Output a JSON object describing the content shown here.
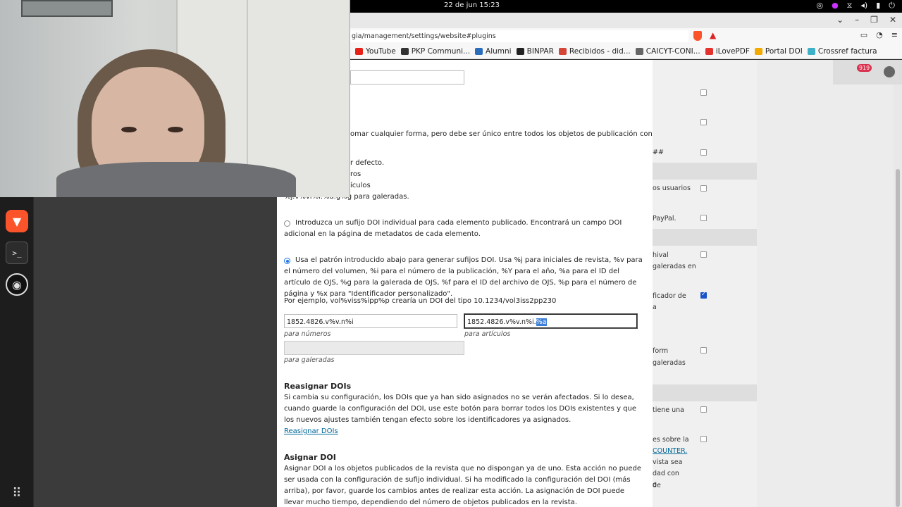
{
  "topbar": {
    "clock": "22 de jun  15:23"
  },
  "browser": {
    "url": "gia/management/settings/website#plugins",
    "bookmarks": [
      {
        "label": "YouTube",
        "icon": "youtube-icon",
        "color": "#e62117"
      },
      {
        "label": "PKP Communi...",
        "icon": "pkp-icon",
        "color": "#333333"
      },
      {
        "label": "Alumni",
        "icon": "alumni-icon",
        "color": "#2a6ebb"
      },
      {
        "label": "BINPAR",
        "icon": "binpar-icon",
        "color": "#222222"
      },
      {
        "label": "Recibidos - did...",
        "icon": "gmail-icon",
        "color": "#d44638"
      },
      {
        "label": "CAICYT-CONI...",
        "icon": "caicyt-icon",
        "color": "#666666"
      },
      {
        "label": "iLovePDF",
        "icon": "heart-icon",
        "color": "#e5322d"
      },
      {
        "label": "Portal DOI",
        "icon": "doi-icon",
        "color": "#f2a900"
      },
      {
        "label": "Crossref factura",
        "icon": "crossref-icon",
        "color": "#3eb1c8"
      }
    ]
  },
  "main": {
    "partial_line_1": "omar cualquier forma, pero debe ser único entre todos los objetos de publicación con el mismo",
    "partial_line_2": "r defecto.",
    "partial_line_3": "ros",
    "partial_line_4": "ículos",
    "partial_line_5": "%j.v%vi%i.%a.g%g para galeradas.",
    "option_individual": "Introduzca un sufijo DOI individual para cada elemento publicado. Encontrará un campo DOI adicional en la página de metadatos de cada elemento.",
    "option_pattern": "Usa el patrón introducido abajo para generar sufijos DOI. Usa %j para iniciales de revista, %v para el número del volumen, %i para el número de la publicación, %Y para el año, %a para el ID del artículo de OJS, %g para la galerada de OJS, %f para el ID del archivo de OJS, %p para el número de página y %x para \"Identificador personalizado\".",
    "example": "Por ejemplo, vol%viss%ipp%p crearía un DOI del tipo 10.1234/vol3iss2pp230",
    "issue_pattern_value": "1852.4826.v%v.n%i",
    "issue_pattern_caption": "para números",
    "article_pattern_value": "1852.4826.v%v.n%i.",
    "article_pattern_selected": "%a",
    "article_pattern_caption": "para artículos",
    "galley_pattern_value": "",
    "galley_pattern_caption": "para galeradas",
    "reassign_title": "Reasignar DOIs",
    "reassign_text": "Si cambia su configuración, los DOIs que ya han sido asignados no se verán afectados. Si lo desea, cuando guarde la configuración del DOI, use este botón para borrar todos los DOIs existentes y que los nuevos ajustes también tengan efecto sobre los identificadores ya asignados.",
    "reassign_link": "Reasignar DOIs",
    "assign_title": "Asignar DOI",
    "assign_text": "Asignar DOI a los objetos publicados de la revista que no dispongan ya de uno. Esta acción no puede ser usada con la configuración de sufijo individual. Si ha modificado la configuración del DOI (más arriba), por favor, guarde los cambios antes de realizar esta acción. La asignación de DOI puede llevar mucho tiempo, dependiendo del número de objetos publicados en la revista."
  },
  "right_panel": {
    "notification_count": "919",
    "rows": [
      {
        "text": "##"
      },
      {
        "text": "os usuarios"
      },
      {
        "text": "PayPal."
      },
      {
        "text": "hival"
      },
      {
        "text": "galeradas en"
      },
      {
        "text": "ficador de"
      },
      {
        "text": "a"
      },
      {
        "text": "form"
      },
      {
        "text": "galeradas"
      },
      {
        "text": "tiene una"
      },
      {
        "text": "es sobre la"
      },
      {
        "text": "COUNTER."
      },
      {
        "text": "vista sea"
      },
      {
        "text": "dad con"
      },
      {
        "text": "o"
      },
      {
        "text": "de"
      }
    ]
  }
}
